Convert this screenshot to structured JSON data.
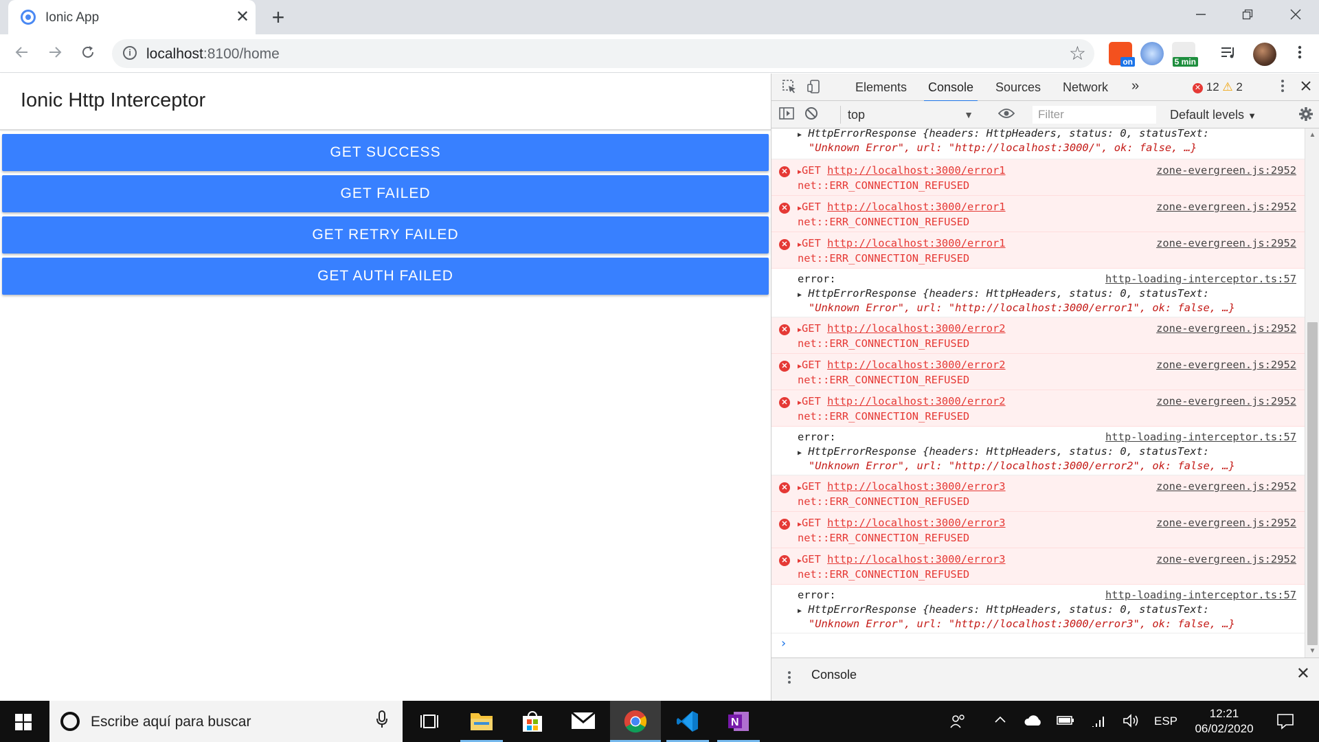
{
  "browser": {
    "tab_title": "Ionic App",
    "tab_close": "✕",
    "new_tab": "+",
    "url_host": "localhost",
    "url_path": ":8100/home",
    "ext_badge_on": "on",
    "ext_badge_timer": "5 min"
  },
  "app": {
    "title": "Ionic Http Interceptor",
    "buttons": [
      "GET SUCCESS",
      "GET FAILED",
      "GET RETRY FAILED",
      "GET AUTH FAILED"
    ],
    "button_color": "#3880ff"
  },
  "devtools": {
    "tabs": [
      "Elements",
      "Console",
      "Sources",
      "Network"
    ],
    "more_tabs": "»",
    "error_count": "12",
    "warning_count": "2",
    "context": "top",
    "filter_placeholder": "Filter",
    "levels": "Default levels",
    "drawer_tab": "Console",
    "messages": [
      {
        "type": "log",
        "partial": true,
        "obj_name": "HttpErrorResponse",
        "obj_rest": "{headers: HttpHeaders, status: 0, statusText:",
        "detail": "\"Unknown Error\", url: \"http://localhost:3000/\", ok: false, …}"
      },
      {
        "type": "error",
        "method": "GET",
        "url": "http://localhost:3000/error1",
        "source": "zone-evergreen.js:2952",
        "text": "net::ERR_CONNECTION_REFUSED"
      },
      {
        "type": "error",
        "method": "GET",
        "url": "http://localhost:3000/error1",
        "source": "zone-evergreen.js:2952",
        "text": "net::ERR_CONNECTION_REFUSED"
      },
      {
        "type": "error",
        "method": "GET",
        "url": "http://localhost:3000/error1",
        "source": "zone-evergreen.js:2952",
        "text": "net::ERR_CONNECTION_REFUSED"
      },
      {
        "type": "log",
        "label": "error:",
        "source": "http-loading-interceptor.ts:57",
        "obj_name": "HttpErrorResponse",
        "obj_rest": "{headers: HttpHeaders, status: 0, statusText:",
        "detail": "\"Unknown Error\", url: \"http://localhost:3000/error1\", ok: false, …}"
      },
      {
        "type": "error",
        "method": "GET",
        "url": "http://localhost:3000/error2",
        "source": "zone-evergreen.js:2952",
        "text": "net::ERR_CONNECTION_REFUSED"
      },
      {
        "type": "error",
        "method": "GET",
        "url": "http://localhost:3000/error2",
        "source": "zone-evergreen.js:2952",
        "text": "net::ERR_CONNECTION_REFUSED"
      },
      {
        "type": "error",
        "method": "GET",
        "url": "http://localhost:3000/error2",
        "source": "zone-evergreen.js:2952",
        "text": "net::ERR_CONNECTION_REFUSED"
      },
      {
        "type": "log",
        "label": "error:",
        "source": "http-loading-interceptor.ts:57",
        "obj_name": "HttpErrorResponse",
        "obj_rest": "{headers: HttpHeaders, status: 0, statusText:",
        "detail": "\"Unknown Error\", url: \"http://localhost:3000/error2\", ok: false, …}"
      },
      {
        "type": "error",
        "method": "GET",
        "url": "http://localhost:3000/error3",
        "source": "zone-evergreen.js:2952",
        "text": "net::ERR_CONNECTION_REFUSED"
      },
      {
        "type": "error",
        "method": "GET",
        "url": "http://localhost:3000/error3",
        "source": "zone-evergreen.js:2952",
        "text": "net::ERR_CONNECTION_REFUSED"
      },
      {
        "type": "error",
        "method": "GET",
        "url": "http://localhost:3000/error3",
        "source": "zone-evergreen.js:2952",
        "text": "net::ERR_CONNECTION_REFUSED"
      },
      {
        "type": "log",
        "label": "error:",
        "source": "http-loading-interceptor.ts:57",
        "obj_name": "HttpErrorResponse",
        "obj_rest": "{headers: HttpHeaders, status: 0, statusText:",
        "detail": "\"Unknown Error\", url: \"http://localhost:3000/error3\", ok: false, …}"
      }
    ]
  },
  "taskbar": {
    "search_placeholder": "Escribe aquí para buscar",
    "language": "ESP",
    "time": "12:21",
    "date": "06/02/2020",
    "apps": [
      "task-view-icon",
      "file-explorer-icon",
      "store-icon",
      "mail-icon",
      "chrome-icon",
      "vscode-icon",
      "onenote-icon"
    ]
  }
}
